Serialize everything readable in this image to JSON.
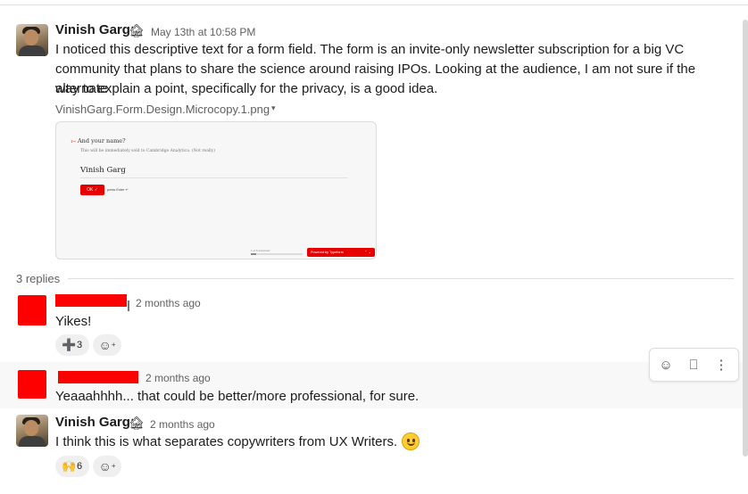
{
  "parent_message": {
    "author": "Vinish Garg",
    "status_emoji": "🏚",
    "timestamp": "May 13th at 10:58 PM",
    "text_lines": [
      "I noticed this descriptive text for a form field. The form is an invite-only newsletter subscription for a big VC",
      "community that plans to share the science around raising IPOs. Looking at the audience, I am not sure if the alternate",
      "way to explain a point, specifically for the privacy, is a good idea."
    ],
    "attachment": {
      "file_name": "VinishGarg.Form.Design.Microcopy.1.png",
      "caret_icon": "▾",
      "preview": {
        "question_number": "1→",
        "question": "And your name?",
        "description": "This will be immediately sold to Cambridge Analytica. (Not really)",
        "answer": "Vinish Garg",
        "ok_label": "OK ✓",
        "enter_hint": "press Enter ↵",
        "progress_text": "1 of 6 answered",
        "progress_fraction": 0.1,
        "powered_by": "Powered by Typeform",
        "nav_arrows": "⌃  ⌄"
      }
    }
  },
  "replies_label": "3 replies",
  "replies": [
    {
      "timestamp": "2 months ago",
      "text": "Yikes!",
      "reactions": [
        {
          "emoji": "➕",
          "count": "3"
        }
      ]
    },
    {
      "timestamp": "2 months ago",
      "text": "Yeaaahhhh... that could be better/more professional, for sure."
    },
    {
      "author": "Vinish Garg",
      "status_emoji": "🏚",
      "timestamp": "2 months ago",
      "text": "I think this is what separates copywriters from UX Writers.",
      "reactions": [
        {
          "emoji": "🙌",
          "count": "6"
        }
      ]
    }
  ],
  "add_reaction_icon": "☺",
  "action_bar": {
    "add_reaction_icon": "☺",
    "bookmark_icon": "⎕",
    "more_icon": "⋮"
  },
  "colors": {
    "redaction": "#ff0000",
    "typeform_red": "#e80000",
    "hover_background": "#f8f8f8"
  }
}
